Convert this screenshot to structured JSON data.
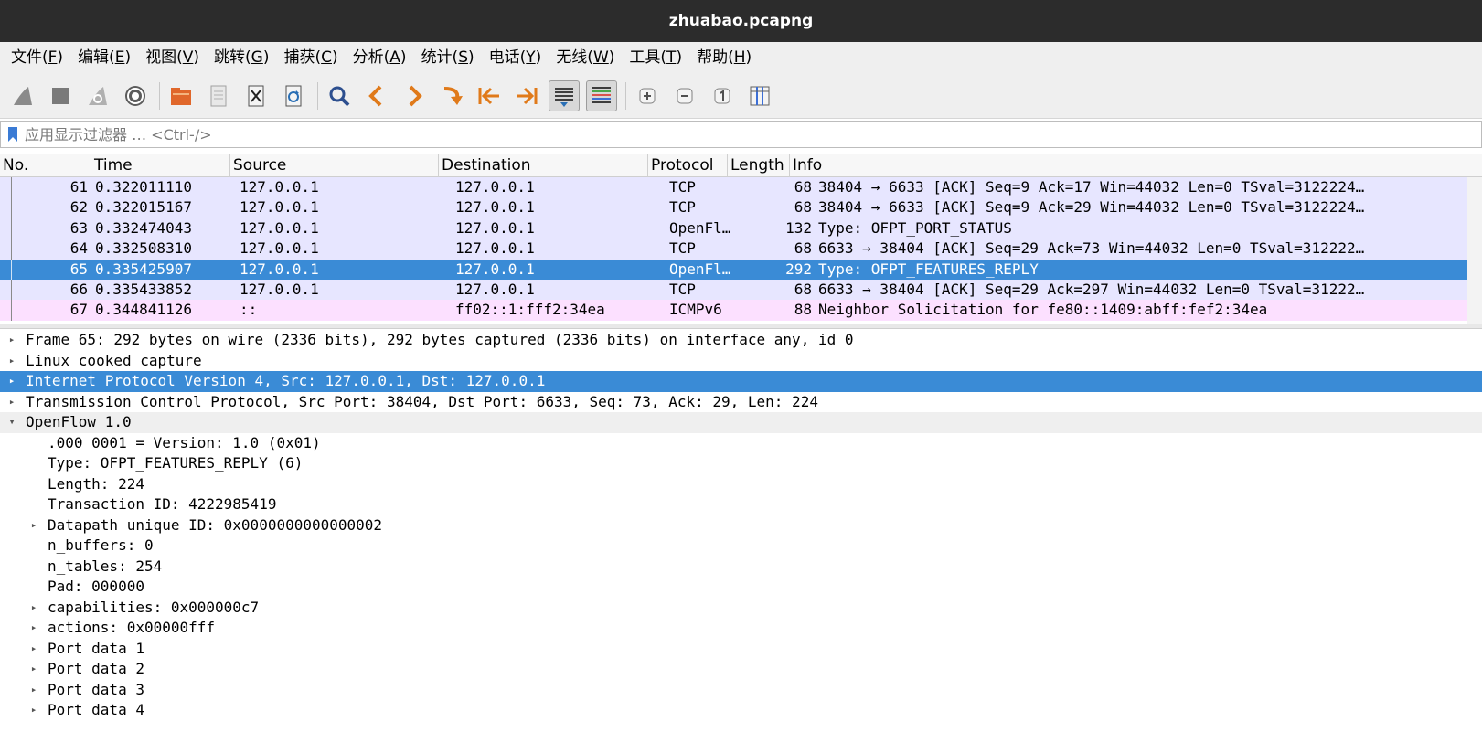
{
  "window": {
    "title": "zhuabao.pcapng"
  },
  "menu": [
    {
      "label": "文件(",
      "acc": "F",
      "end": ")"
    },
    {
      "label": "编辑(",
      "acc": "E",
      "end": ")"
    },
    {
      "label": "视图(",
      "acc": "V",
      "end": ")"
    },
    {
      "label": "跳转(",
      "acc": "G",
      "end": ")"
    },
    {
      "label": "捕获(",
      "acc": "C",
      "end": ")"
    },
    {
      "label": "分析(",
      "acc": "A",
      "end": ")"
    },
    {
      "label": "统计(",
      "acc": "S",
      "end": ")"
    },
    {
      "label": "电话(",
      "acc": "Y",
      "end": ")"
    },
    {
      "label": "无线(",
      "acc": "W",
      "end": ")"
    },
    {
      "label": "工具(",
      "acc": "T",
      "end": ")"
    },
    {
      "label": "帮助(",
      "acc": "H",
      "end": ")"
    }
  ],
  "filter": {
    "placeholder": "应用显示过滤器 … <Ctrl-/>"
  },
  "columns": {
    "no": "No.",
    "time": "Time",
    "source": "Source",
    "destination": "Destination",
    "protocol": "Protocol",
    "length": "Length",
    "info": "Info"
  },
  "colors": {
    "row_tcp": "#e7e6ff",
    "row_icmpv6": "#fce0ff",
    "row_selected": "#3a8bd6"
  },
  "packets": [
    {
      "no": "61",
      "time": "0.322011110",
      "source": "127.0.0.1",
      "destination": "127.0.0.1",
      "protocol": "TCP",
      "length": "68",
      "info": "38404 → 6633 [ACK] Seq=9 Ack=17 Win=44032 Len=0 TSval=3122224…",
      "kind": "tcp",
      "selected": false
    },
    {
      "no": "62",
      "time": "0.322015167",
      "source": "127.0.0.1",
      "destination": "127.0.0.1",
      "protocol": "TCP",
      "length": "68",
      "info": "38404 → 6633 [ACK] Seq=9 Ack=29 Win=44032 Len=0 TSval=3122224…",
      "kind": "tcp",
      "selected": false
    },
    {
      "no": "63",
      "time": "0.332474043",
      "source": "127.0.0.1",
      "destination": "127.0.0.1",
      "protocol": "OpenFl…",
      "length": "132",
      "info": "Type: OFPT_PORT_STATUS",
      "kind": "tcp",
      "selected": false
    },
    {
      "no": "64",
      "time": "0.332508310",
      "source": "127.0.0.1",
      "destination": "127.0.0.1",
      "protocol": "TCP",
      "length": "68",
      "info": "6633 → 38404 [ACK] Seq=29 Ack=73 Win=44032 Len=0 TSval=312222…",
      "kind": "tcp",
      "selected": false
    },
    {
      "no": "65",
      "time": "0.335425907",
      "source": "127.0.0.1",
      "destination": "127.0.0.1",
      "protocol": "OpenFl…",
      "length": "292",
      "info": "Type: OFPT_FEATURES_REPLY",
      "kind": "tcp",
      "selected": true
    },
    {
      "no": "66",
      "time": "0.335433852",
      "source": "127.0.0.1",
      "destination": "127.0.0.1",
      "protocol": "TCP",
      "length": "68",
      "info": "6633 → 38404 [ACK] Seq=29 Ack=297 Win=44032 Len=0 TSval=31222…",
      "kind": "tcp",
      "selected": false
    },
    {
      "no": "67",
      "time": "0.344841126",
      "source": "::",
      "destination": "ff02::1:fff2:34ea",
      "protocol": "ICMPv6",
      "length": "88",
      "info": "Neighbor Solicitation for fe80::1409:abff:fef2:34ea",
      "kind": "icmpv6",
      "selected": false
    }
  ],
  "details": [
    {
      "text": "Frame 65: 292 bytes on wire (2336 bits), 292 bytes captured (2336 bits) on interface any, id 0",
      "level": 0,
      "arrow": "collapsed",
      "selected": false
    },
    {
      "text": "Linux cooked capture",
      "level": 0,
      "arrow": "collapsed",
      "selected": false
    },
    {
      "text": "Internet Protocol Version 4, Src: 127.0.0.1, Dst: 127.0.0.1",
      "level": 0,
      "arrow": "collapsed",
      "selected": true
    },
    {
      "text": "Transmission Control Protocol, Src Port: 38404, Dst Port: 6633, Seq: 73, Ack: 29, Len: 224",
      "level": 0,
      "arrow": "collapsed",
      "selected": false
    },
    {
      "text": "OpenFlow 1.0",
      "level": 0,
      "arrow": "expanded",
      "selected": false,
      "hover": true
    },
    {
      "text": ".000 0001 = Version: 1.0 (0x01)",
      "level": 1,
      "arrow": "none",
      "selected": false
    },
    {
      "text": "Type: OFPT_FEATURES_REPLY (6)",
      "level": 1,
      "arrow": "none",
      "selected": false
    },
    {
      "text": "Length: 224",
      "level": 1,
      "arrow": "none",
      "selected": false
    },
    {
      "text": "Transaction ID: 4222985419",
      "level": 1,
      "arrow": "none",
      "selected": false
    },
    {
      "text": "Datapath unique ID: 0x0000000000000002",
      "level": 1,
      "arrow": "collapsed",
      "selected": false
    },
    {
      "text": "n_buffers: 0",
      "level": 1,
      "arrow": "none",
      "selected": false
    },
    {
      "text": "n_tables: 254",
      "level": 1,
      "arrow": "none",
      "selected": false
    },
    {
      "text": "Pad: 000000",
      "level": 1,
      "arrow": "none",
      "selected": false
    },
    {
      "text": "capabilities: 0x000000c7",
      "level": 1,
      "arrow": "collapsed",
      "selected": false
    },
    {
      "text": "actions: 0x00000fff",
      "level": 1,
      "arrow": "collapsed",
      "selected": false
    },
    {
      "text": "Port data 1",
      "level": 1,
      "arrow": "collapsed",
      "selected": false
    },
    {
      "text": "Port data 2",
      "level": 1,
      "arrow": "collapsed",
      "selected": false
    },
    {
      "text": "Port data 3",
      "level": 1,
      "arrow": "collapsed",
      "selected": false
    },
    {
      "text": "Port data 4",
      "level": 1,
      "arrow": "collapsed",
      "selected": false
    }
  ]
}
